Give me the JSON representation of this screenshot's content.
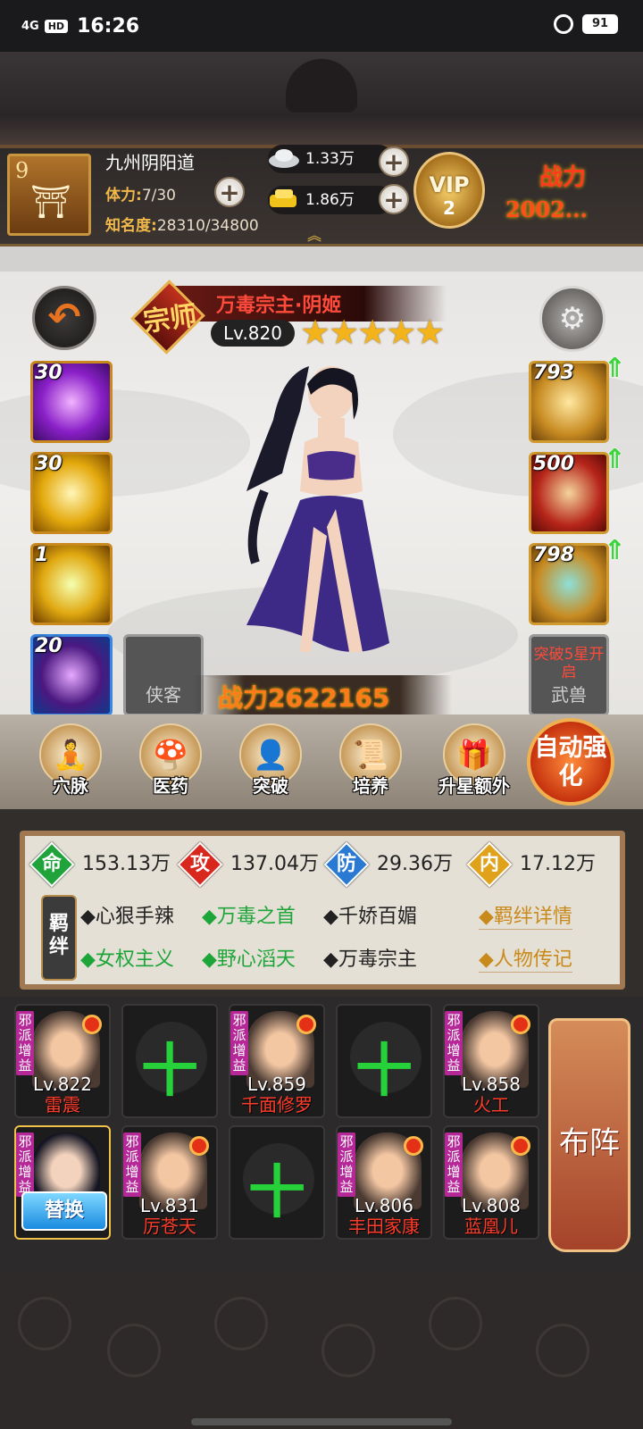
{
  "status_bar": {
    "signal": "4G",
    "hd": "HD",
    "time": "16:26",
    "battery": "91"
  },
  "player": {
    "level": "9",
    "name": "九州阴阳道",
    "stamina_label": "体力:",
    "stamina": "7/30",
    "fame_label": "知名度:",
    "fame": "28310/34800",
    "silver": "1.33万",
    "gold": "1.86万",
    "vip_label": "VIP",
    "vip_level": "2",
    "power_label": "战力",
    "power_value": "2002..."
  },
  "hero": {
    "rank_badge": "宗师",
    "name": "万毒宗主·阴姬",
    "level": "Lv.820",
    "stars": "★★★★★",
    "power": "战力2622165"
  },
  "skills": [
    {
      "level": "30",
      "color": "#9b2bd6"
    },
    {
      "level": "30",
      "color": "#e2b10e"
    },
    {
      "level": "1",
      "color": "#e7b013"
    },
    {
      "level": "20",
      "color": "#2a6fd0"
    }
  ],
  "locked_slot": {
    "label": "侠客"
  },
  "equipment": [
    {
      "level": "793"
    },
    {
      "level": "500"
    },
    {
      "level": "798"
    }
  ],
  "beast_slot": {
    "requirement": "突破5星开启",
    "label": "武兽"
  },
  "nav": [
    {
      "label": "穴脉",
      "icon": "meridian-icon"
    },
    {
      "label": "医药",
      "icon": "mushroom-icon"
    },
    {
      "label": "突破",
      "icon": "breakthrough-icon"
    },
    {
      "label": "培养",
      "icon": "scroll-icon"
    },
    {
      "label": "升星额外",
      "icon": "treasure-icon"
    }
  ],
  "auto_button": "自动强化",
  "stats": [
    {
      "label": "命",
      "value": "153.13万",
      "color": "#1fa33a"
    },
    {
      "label": "攻",
      "value": "137.04万",
      "color": "#d8271c"
    },
    {
      "label": "防",
      "value": "29.36万",
      "color": "#2a7ad3"
    },
    {
      "label": "内",
      "value": "17.12万",
      "color": "#e0a21a"
    }
  ],
  "bonds_label": "羁绊",
  "bonds": [
    {
      "text": "◆心狠手辣",
      "active": false
    },
    {
      "text": "◆万毒之首",
      "active": true
    },
    {
      "text": "◆千娇百媚",
      "active": false
    },
    {
      "text": "◆女权主义",
      "active": true
    },
    {
      "text": "◆野心滔天",
      "active": true
    },
    {
      "text": "◆万毒宗主",
      "active": false
    }
  ],
  "links": {
    "bond_detail": "◆羁绊详情",
    "biography": "◆人物传记"
  },
  "team": {
    "faction_tag": "邪派增益",
    "members": [
      {
        "level": "Lv.822",
        "name": "雷震"
      },
      {
        "empty": true
      },
      {
        "level": "Lv.859",
        "name": "千面修罗"
      },
      {
        "empty": true
      },
      {
        "level": "Lv.858",
        "name": "火工"
      },
      {
        "current": true,
        "swap_label": "替换"
      },
      {
        "level": "Lv.831",
        "name": "厉苍天"
      },
      {
        "empty": true
      },
      {
        "level": "Lv.806",
        "name": "丰田家康"
      },
      {
        "level": "Lv.808",
        "name": "蓝凰儿"
      }
    ],
    "plus": "十",
    "formation_button": "布阵"
  }
}
